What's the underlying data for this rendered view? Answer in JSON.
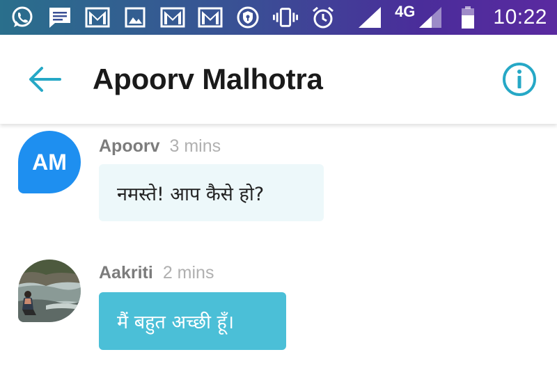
{
  "status_bar": {
    "network": "4G",
    "time": "10:22",
    "icons": [
      "whatsapp-icon",
      "message-icon",
      "gmail-icon",
      "image-icon",
      "gmail-icon",
      "gmail-icon",
      "vpn-shield-icon",
      "vibrate-icon",
      "alarm-icon",
      "signal-icon",
      "signal-icon",
      "battery-icon"
    ]
  },
  "header": {
    "title": "Apoorv Malhotra",
    "back_icon": "back-arrow-icon",
    "info_icon": "info-icon"
  },
  "colors": {
    "accent": "#26a8c6",
    "avatar_blue": "#1e8ff0",
    "incoming_bubble": "#edf8fa",
    "outgoing_bubble": "#4bbfd7"
  },
  "messages": [
    {
      "sender": "Apoorv",
      "time": "3 mins",
      "avatar_initials": "AM",
      "text": "नमस्ते! आप कैसे हो?"
    },
    {
      "sender": "Aakriti",
      "time": "2 mins",
      "avatar_initials": "",
      "text": "मैं बहुत अच्छी हूँ।"
    }
  ]
}
